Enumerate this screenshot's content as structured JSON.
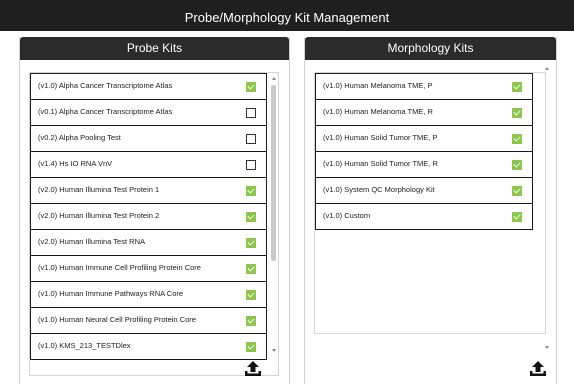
{
  "app": {
    "title": "Probe/Morphology Kit Management"
  },
  "probe_kits": {
    "header": "Probe Kits",
    "items": [
      {
        "label": "(v1.0) Alpha Cancer Transcriptome Atlas",
        "checked": true
      },
      {
        "label": "(v0.1) Alpha Cancer Transcriptome Atlas",
        "checked": false
      },
      {
        "label": "(v0.2) Alpha Pooling Test",
        "checked": false
      },
      {
        "label": "(v1.4) Hs IO RNA VnV",
        "checked": false
      },
      {
        "label": "(v2.0) Human Illumina Test Protein 1",
        "checked": true
      },
      {
        "label": "(v2.0) Human Illumina Test Protein 2",
        "checked": true
      },
      {
        "label": "(v2.0) Human Illumina Test RNA",
        "checked": true
      },
      {
        "label": "(v1.0) Human Immune Cell Profiling Protein Core",
        "checked": true
      },
      {
        "label": "(v1.0) Human Immune Pathways RNA Core",
        "checked": true
      },
      {
        "label": "(v1.0) Human Neural Cell Profiling Protein Core",
        "checked": true
      },
      {
        "label": "(v1.0) KMS_213_TESTDlex",
        "checked": true
      }
    ],
    "upload_icon": "upload-icon"
  },
  "morphology_kits": {
    "header": "Morphology Kits",
    "items": [
      {
        "label": "(v1.0) Human Melanoma TME, P",
        "checked": true
      },
      {
        "label": "(v1.0) Human Melanoma TME, R",
        "checked": true
      },
      {
        "label": "(v1.0) Human Solid Tumor TME, P",
        "checked": true
      },
      {
        "label": "(v1.0) Human Solid Tumor TME, R",
        "checked": true
      },
      {
        "label": "(v1.0) System QC Morphology Kit",
        "checked": true
      },
      {
        "label": "(v1.0) Custom",
        "checked": true
      }
    ],
    "upload_icon": "upload-icon"
  },
  "colors": {
    "header_bg": "#2b2b2b",
    "title_bar_bg": "#1f1f1f",
    "checked_green": "#8cc64a"
  }
}
